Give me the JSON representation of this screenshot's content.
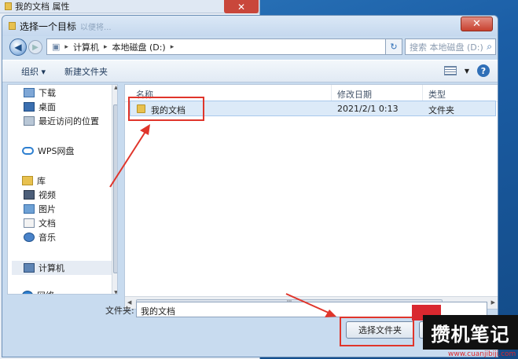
{
  "background_window": {
    "title": "我的文档 属性",
    "close_label": "✕"
  },
  "dialog": {
    "title": "选择一个目标",
    "title_faded": "以便将...",
    "close_label": "✕"
  },
  "address": {
    "crumbs": [
      "计算机",
      "本地磁盘 (D:)"
    ],
    "separator": "▸",
    "search_placeholder": "搜索 本地磁盘 (D:)"
  },
  "toolbar": {
    "organize_label": "组织 ▾",
    "new_folder_label": "新建文件夹"
  },
  "nav": {
    "items": [
      {
        "label": "下载",
        "icon": "download-folder-icon"
      },
      {
        "label": "桌面",
        "icon": "desktop-icon"
      },
      {
        "label": "最近访问的位置",
        "icon": "recent-places-icon"
      },
      {
        "label": "WPS网盘",
        "icon": "cloud-drive-icon"
      },
      {
        "label": "库",
        "icon": "library-icon"
      },
      {
        "label": "视频",
        "icon": "video-icon"
      },
      {
        "label": "图片",
        "icon": "picture-icon"
      },
      {
        "label": "文档",
        "icon": "document-icon"
      },
      {
        "label": "音乐",
        "icon": "music-icon"
      },
      {
        "label": "计算机",
        "icon": "computer-icon"
      },
      {
        "label": "网络",
        "icon": "network-icon"
      }
    ]
  },
  "files": {
    "columns": [
      "名称",
      "修改日期",
      "类型"
    ],
    "rows": [
      {
        "name": "我的文档",
        "date": "2021/2/1 0:13",
        "type": "文件夹"
      }
    ],
    "scroll_grip": "III"
  },
  "bottom": {
    "folder_label": "文件夹:",
    "folder_value": "我的文档",
    "select_button": "选择文件夹"
  },
  "watermark": {
    "text": "攒机笔记",
    "url": "www.cuanjibiji.com"
  },
  "colors": {
    "highlight": "#e0352b",
    "selection": "#dceaf8"
  }
}
